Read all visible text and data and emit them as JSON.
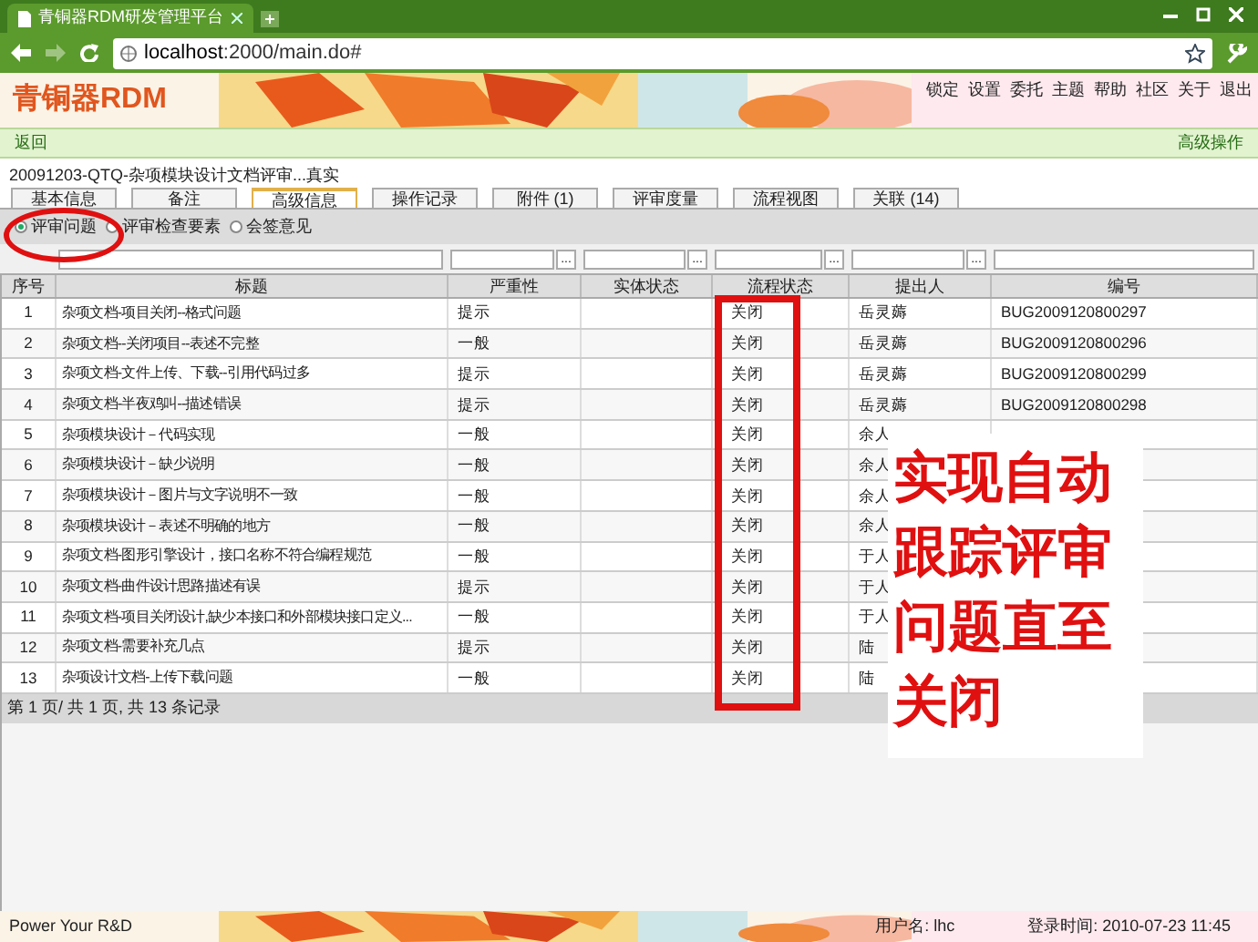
{
  "browser": {
    "tab_title": "青铜器RDM研发管理平台",
    "url_host": "localhost",
    "url_rest": ":2000/main.do#"
  },
  "header": {
    "logo": "青铜器RDM",
    "menu": [
      "锁定",
      "设置",
      "委托",
      "主题",
      "帮助",
      "社区",
      "关于",
      "退出"
    ]
  },
  "action_bar": {
    "back": "返回",
    "advanced": "高级操作"
  },
  "record_title": "20091203-QTQ-杂项模块设计文档评审...真实",
  "tabs": [
    {
      "label": "基本信息",
      "selected": false
    },
    {
      "label": "备注",
      "selected": false
    },
    {
      "label": "高级信息",
      "selected": true
    },
    {
      "label": "操作记录",
      "selected": false
    },
    {
      "label": "附件 (1)",
      "selected": false
    },
    {
      "label": "评审度量",
      "selected": false
    },
    {
      "label": "流程视图",
      "selected": false
    },
    {
      "label": "关联 (14)",
      "selected": false
    }
  ],
  "radios": [
    {
      "label": "评审问题",
      "selected": true
    },
    {
      "label": "评审检查要素",
      "selected": false
    },
    {
      "label": "会签意见",
      "selected": false
    }
  ],
  "filters": [
    {
      "kind": "none"
    },
    {
      "kind": "text"
    },
    {
      "kind": "picker",
      "button": "..."
    },
    {
      "kind": "picker",
      "button": "..."
    },
    {
      "kind": "picker",
      "button": "..."
    },
    {
      "kind": "picker",
      "button": "..."
    },
    {
      "kind": "text"
    }
  ],
  "table": {
    "columns": [
      "序号",
      "标题",
      "严重性",
      "实体状态",
      "流程状态",
      "提出人",
      "编号"
    ],
    "rows": [
      [
        "1",
        "杂项文档-项目关闭--格式问题",
        "提示",
        "",
        "关闭",
        "岳灵薅",
        "BUG2009120800297"
      ],
      [
        "2",
        "杂项文档--关闭项目--表述不完整",
        "一般",
        "",
        "关闭",
        "岳灵薅",
        "BUG2009120800296"
      ],
      [
        "3",
        "杂项文档-文件上传、下载--引用代码过多",
        "提示",
        "",
        "关闭",
        "岳灵薅",
        "BUG2009120800299"
      ],
      [
        "4",
        "杂项文档-半夜鸡叫--描述错误",
        "提示",
        "",
        "关闭",
        "岳灵薅",
        "BUG2009120800298"
      ],
      [
        "5",
        "杂项模块设计－代码实现",
        "一般",
        "",
        "关闭",
        "余人",
        ""
      ],
      [
        "6",
        "杂项模块设计－缺少说明",
        "一般",
        "",
        "关闭",
        "余人",
        ""
      ],
      [
        "7",
        "杂项模块设计－图片与文字说明不一致",
        "一般",
        "",
        "关闭",
        "余人",
        ""
      ],
      [
        "8",
        "杂项模块设计－表述不明确的地方",
        "一般",
        "",
        "关闭",
        "余人",
        ""
      ],
      [
        "9",
        "杂项文档-图形引擎设计，接口名称不符合编程规范",
        "一般",
        "",
        "关闭",
        "于人",
        ""
      ],
      [
        "10",
        "杂项文档-曲件设计思路描述有误",
        "提示",
        "",
        "关闭",
        "于人",
        ""
      ],
      [
        "11",
        "杂项文档-项目关闭设计,缺少本接口和外部模块接口定义...",
        "一般",
        "",
        "关闭",
        "于人",
        ""
      ],
      [
        "12",
        "杂项文档-需要补充几点",
        "提示",
        "",
        "关闭",
        "陆",
        ""
      ],
      [
        "13",
        "杂项设计文档-上传下载问题",
        "一般",
        "",
        "关闭",
        "陆",
        ""
      ]
    ]
  },
  "pager": "第 1 页/ 共 1 页, 共 13 条记录",
  "annotation": {
    "text": "实现自动跟踪评审问题直至关闭"
  },
  "footer": {
    "slogan": "Power Your R&D",
    "user": "用户名: lhc",
    "login_time": "登录时间: 2010-07-23 11:45"
  }
}
